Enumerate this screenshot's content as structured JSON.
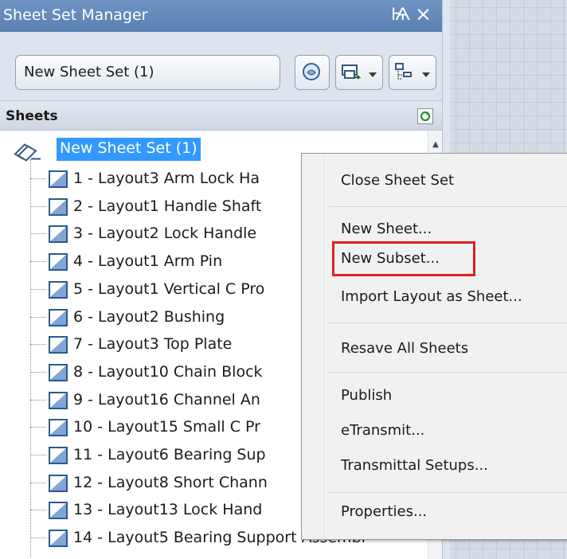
{
  "palette": {
    "title": "Sheet Set Manager",
    "pin_glyph": "Ѩ",
    "close_glyph": "×",
    "sheet_set_selector": "New Sheet Set (1)",
    "toolbar_icons": [
      "view-icon",
      "publish-icon",
      "list-view-icon"
    ],
    "sheets_header": "Sheets"
  },
  "tree": {
    "root": "New Sheet Set (1)",
    "sheets": [
      "1 - Layout3 Arm Lock Ha",
      "2 - Layout1 Handle Shaft",
      "3 - Layout2 Lock Handle",
      "4 - Layout1 Arm Pin",
      "5 - Layout1 Vertical C Pro",
      "6 - Layout2 Bushing",
      "7 - Layout3 Top Plate",
      "8 - Layout10 Chain Block",
      "9 - Layout16 Channel An",
      "10 - Layout15 Small C Pr",
      "11 - Layout6 Bearing Sup",
      "12 - Layout8 Short Chann",
      "13 - Layout13 Lock Hand",
      "14 - Layout5 Bearing Support Assembl"
    ]
  },
  "context_menu": {
    "items": [
      "Close Sheet Set",
      "New Sheet...",
      "New Subset...",
      "Import Layout as Sheet...",
      "Resave All Sheets",
      "Publish",
      "eTransmit...",
      "Transmittal Setups...",
      "Properties..."
    ],
    "highlighted": "New Subset..."
  },
  "colors": {
    "title_bar": "#5f86b8",
    "selection": "#3399ff",
    "highlight_box": "#e02020"
  }
}
